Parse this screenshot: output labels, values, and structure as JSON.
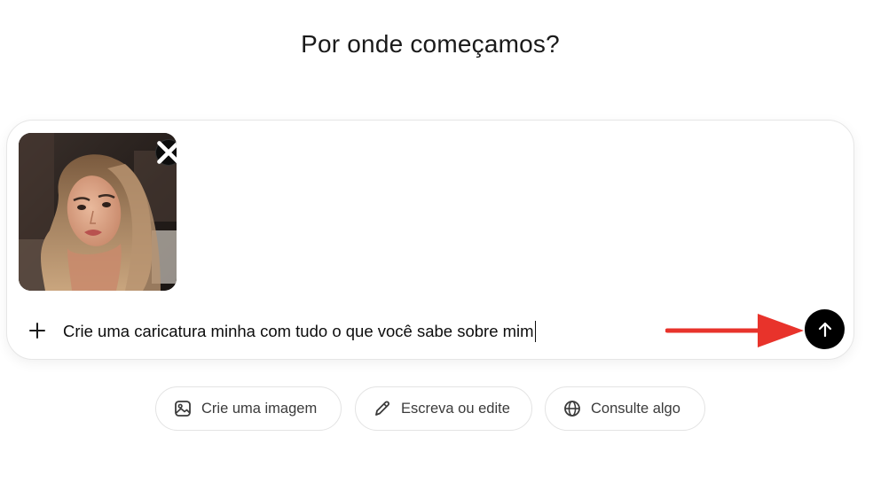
{
  "page": {
    "heading": "Por onde começamos?"
  },
  "composer": {
    "prompt_value": "Crie uma caricatura minha com tudo o que você sabe sobre mim",
    "attachment": {
      "icon": "photo-thumbnail",
      "remove_icon": "close-icon"
    },
    "add_icon": "plus-icon",
    "send_icon": "arrow-up-icon"
  },
  "suggestions": [
    {
      "label": "Crie uma imagem",
      "icon": "image-icon"
    },
    {
      "label": "Escreva ou edite",
      "icon": "pencil-icon"
    },
    {
      "label": "Consulte algo",
      "icon": "globe-icon"
    }
  ],
  "annotation": {
    "arrow_color": "#e8332b"
  }
}
